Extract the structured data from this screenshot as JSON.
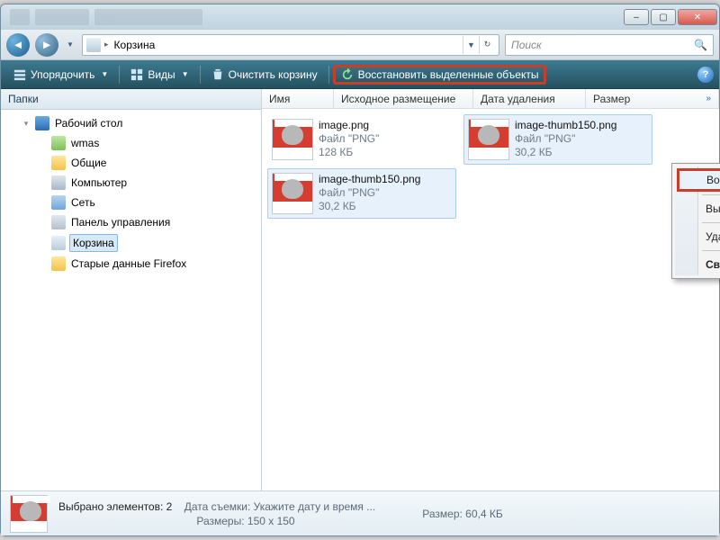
{
  "titlebar": {
    "minimize": "–",
    "maximize": "▢",
    "close": "✕"
  },
  "nav": {
    "back": "◄",
    "forward": "►",
    "dropdown": "▼",
    "crumb_sep": "▸",
    "crumb": "Корзина",
    "addr_drop": "▼",
    "addr_refresh": "↻"
  },
  "search": {
    "placeholder": "Поиск",
    "icon": "🔍"
  },
  "toolbar": {
    "organize": "Упорядочить",
    "views": "Виды",
    "empty": "Очистить корзину",
    "restore": "Восстановить выделенные объекты",
    "arr": "▼"
  },
  "sidebar": {
    "header": "Папки",
    "items": [
      {
        "label": "Рабочий стол",
        "icon": "ico-desktop",
        "tw": "▾",
        "indent": "ind1"
      },
      {
        "label": "wmas",
        "icon": "ico-folder-g",
        "tw": "",
        "indent": "ind2"
      },
      {
        "label": "Общие",
        "icon": "ico-folder",
        "tw": "",
        "indent": "ind2"
      },
      {
        "label": "Компьютер",
        "icon": "ico-comp",
        "tw": "",
        "indent": "ind2"
      },
      {
        "label": "Сеть",
        "icon": "ico-net",
        "tw": "",
        "indent": "ind2"
      },
      {
        "label": "Панель управления",
        "icon": "ico-cpl",
        "tw": "",
        "indent": "ind2"
      },
      {
        "label": "Корзина",
        "icon": "ico-bin",
        "tw": "",
        "indent": "ind2",
        "selected": true
      },
      {
        "label": "Старые данные Firefox",
        "icon": "ico-folder",
        "tw": "",
        "indent": "ind2"
      }
    ]
  },
  "columns": {
    "name": "Имя",
    "orig": "Исходное размещение",
    "date": "Дата удаления",
    "size": "Размер"
  },
  "files": [
    {
      "name": "image.png",
      "type": "Файл \"PNG\"",
      "size": "128 КБ",
      "selected": false
    },
    {
      "name": "image-thumb150.png",
      "type": "Файл \"PNG\"",
      "size": "30,2 КБ",
      "selected": true
    },
    {
      "name": "image-thumb150.png",
      "type": "Файл \"PNG\"",
      "size": "30,2 КБ",
      "selected": true
    }
  ],
  "context_menu": {
    "restore": "Восстановить",
    "cut": "Вырезать",
    "delete": "Удалить",
    "properties": "Свойства"
  },
  "status": {
    "title_prefix": "Выбрано элементов: ",
    "count": "2",
    "date_key": "Дата съемки:",
    "date_val": "Укажите дату и время ...",
    "dim_key": "Размеры:",
    "dim_val": "150 x 150",
    "size_key": "Размер:",
    "size_val": "60,4 КБ"
  }
}
